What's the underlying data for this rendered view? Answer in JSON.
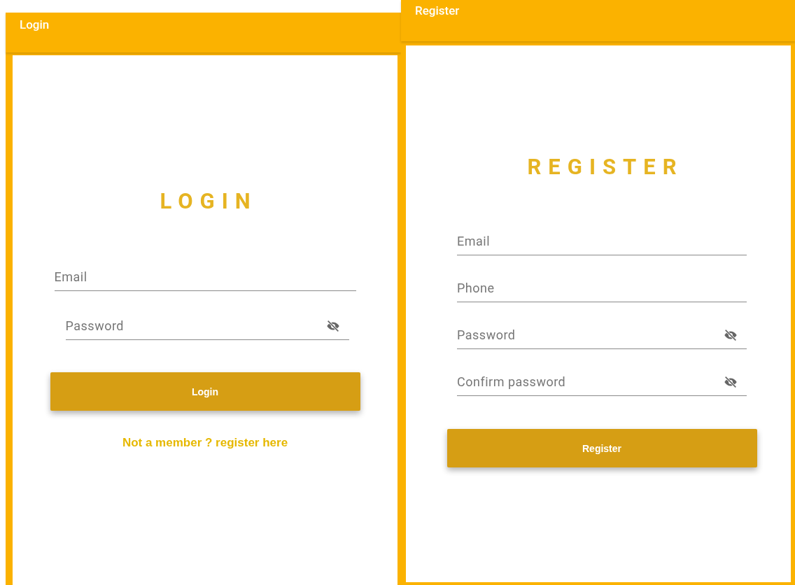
{
  "screens": [
    {
      "title": "Login",
      "heading": "LOGIN",
      "fields": [
        {
          "placeholder": "Email",
          "kind": "text"
        },
        {
          "placeholder": "Password",
          "kind": "password"
        }
      ],
      "button": "Login",
      "link": "Not a member ? register here"
    },
    {
      "title": "Register",
      "heading": "REGISTER",
      "fields": [
        {
          "placeholder": "Email",
          "kind": "text"
        },
        {
          "placeholder": "Phone",
          "kind": "text"
        },
        {
          "placeholder": "Password",
          "kind": "password"
        },
        {
          "placeholder": "Confirm password",
          "kind": "password"
        }
      ],
      "button": "Register"
    }
  ]
}
